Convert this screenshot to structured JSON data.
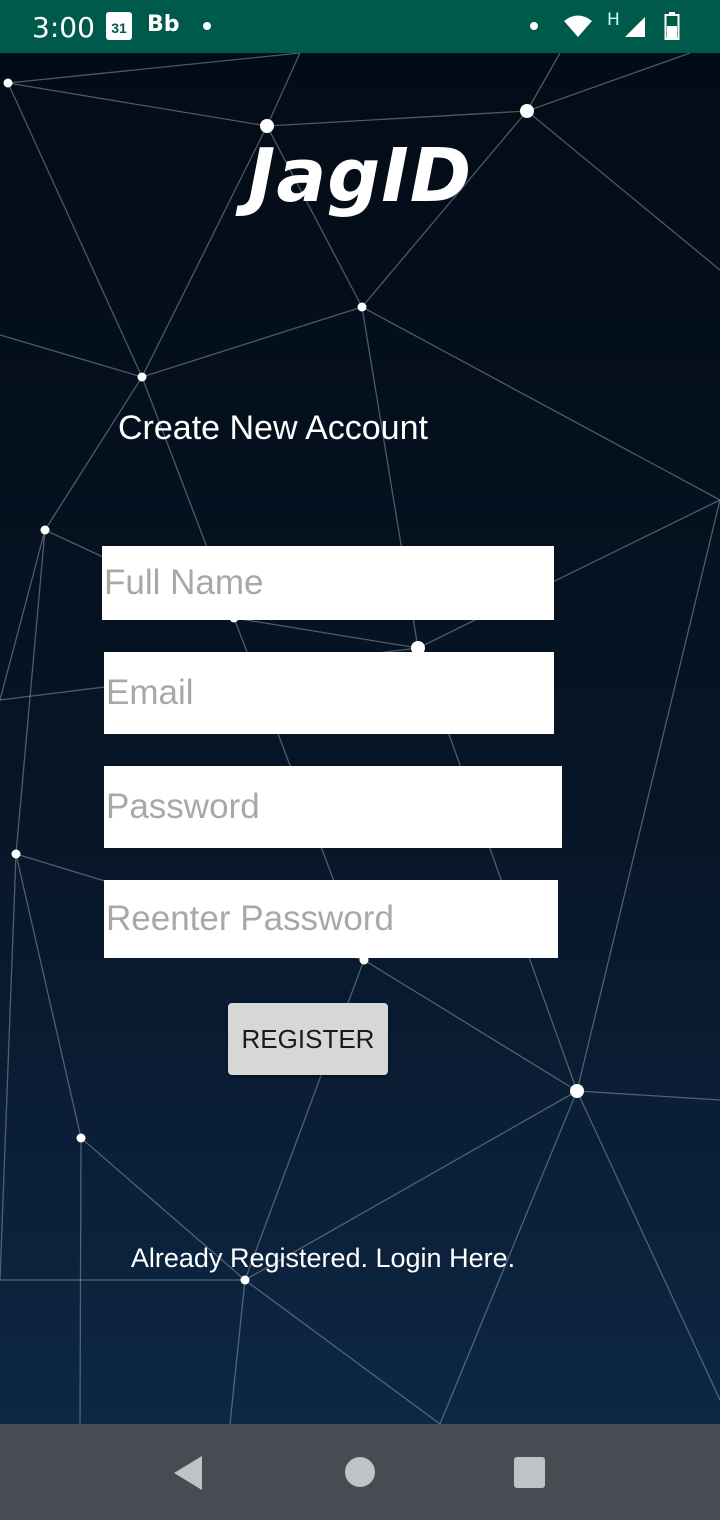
{
  "status_bar": {
    "time": "3:00",
    "calendar_day": "31",
    "app_badge": "Bb",
    "network_label": "H"
  },
  "app": {
    "logo_text": "JagID",
    "heading": "Create New Account"
  },
  "form": {
    "full_name_placeholder": "Full Name",
    "email_placeholder": "Email",
    "password_placeholder": "Password",
    "reenter_password_placeholder": "Reenter Password",
    "register_label": "REGISTER"
  },
  "footer": {
    "login_link": "Already Registered. Login Here."
  },
  "colors": {
    "status_bar": "#005a4c",
    "nav_bar": "#474c52",
    "background_top": "#030b16",
    "background_bottom": "#0d2745",
    "button": "#d6d7d7"
  }
}
